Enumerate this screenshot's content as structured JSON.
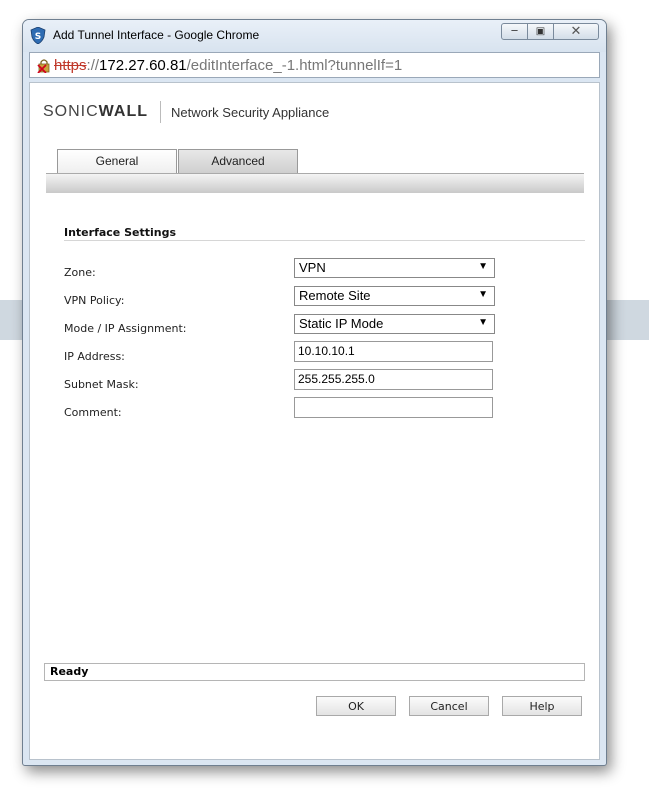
{
  "window": {
    "title": "Add Tunnel Interface - Google Chrome"
  },
  "address": {
    "scheme": "https",
    "separator": "://",
    "host": "172.27.60.81",
    "path": "/editInterface_-1.html?tunnelIf=1"
  },
  "brand": {
    "logo_a": "SONIC",
    "logo_b": "WALL",
    "product": "Network Security Appliance"
  },
  "tabs": [
    {
      "label": "General",
      "selected": true
    },
    {
      "label": "Advanced",
      "selected": false
    }
  ],
  "section": {
    "title": "Interface Settings"
  },
  "fields": {
    "zone": {
      "label": "Zone:",
      "value": "VPN"
    },
    "vpn_policy": {
      "label": "VPN Policy:",
      "value": "Remote Site"
    },
    "mode": {
      "label": "Mode / IP Assignment:",
      "value": "Static IP Mode"
    },
    "ip": {
      "label": "IP Address:",
      "value": "10.10.10.1"
    },
    "mask": {
      "label": "Subnet Mask:",
      "value": "255.255.255.0"
    },
    "comment": {
      "label": "Comment:",
      "value": ""
    }
  },
  "status": {
    "text": "Ready"
  },
  "buttons": {
    "ok": "OK",
    "cancel": "Cancel",
    "help": "Help"
  },
  "icons": {
    "app": "chrome-shield-icon",
    "lock": "insecure-lock-icon",
    "caret": "dropdown-arrow-icon"
  },
  "colors": {
    "insecure": "#c0392b",
    "accent_logo": "#f39200"
  }
}
